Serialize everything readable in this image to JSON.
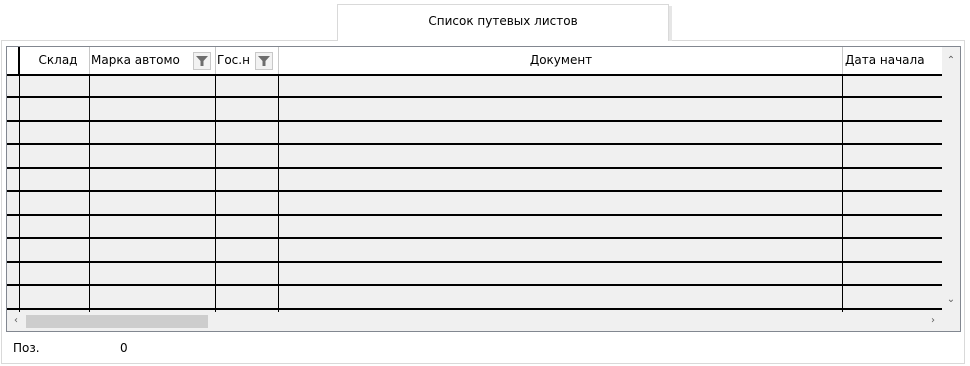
{
  "tab": {
    "label": "Список путевых листов"
  },
  "grid": {
    "columns": [
      {
        "label": "Склад",
        "filter": false
      },
      {
        "label": "Марка автомо",
        "filter": true
      },
      {
        "label": "Гос.н",
        "filter": true
      },
      {
        "label": "Документ",
        "filter": false
      },
      {
        "label": "Дата начала",
        "filter": false
      }
    ],
    "row_count": 10
  },
  "footer": {
    "position_label": "Поз.",
    "position_value": "0"
  },
  "colors": {
    "row_bg": "#f0f0f0",
    "grid_line": "#000000",
    "scroll_thumb": "#cdcdcd"
  }
}
